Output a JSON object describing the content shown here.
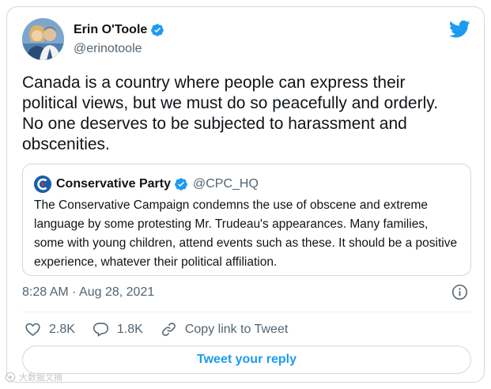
{
  "author": {
    "name": "Erin O'Toole",
    "handle": "@erinotoole"
  },
  "tweet": {
    "text": "Canada is a country where people can express their\npolitical views, but we must do so peacefully and orderly.\nNo one deserves to be subjected to harassment and\nobscenities."
  },
  "quote": {
    "name": "Conservative Party",
    "handle": "@CPC_HQ",
    "text": "The Conservative Campaign condemns the use of obscene and extreme language by some protesting Mr. Trudeau's appearances. Many families, some with young children, attend events such as these. It should be a positive experience, whatever their political affiliation."
  },
  "meta": {
    "timestamp": "8:28 AM · Aug 28, 2021"
  },
  "actions": {
    "likes": "2.8K",
    "replies": "1.8K",
    "copy_link": "Copy link to Tweet"
  },
  "reply_button": {
    "label": "Tweet your reply"
  },
  "watermark": {
    "text": "大数据文摘"
  },
  "colors": {
    "brand_blue": "#1d9bf0",
    "text_primary": "#0f1419",
    "text_secondary": "#536471",
    "border": "#cfd9de"
  },
  "icons": {
    "verified": "verified-badge-icon",
    "brand": "twitter-bird-icon",
    "info": "info-icon",
    "like": "heart-icon",
    "reply": "comment-icon",
    "copy": "link-icon"
  }
}
